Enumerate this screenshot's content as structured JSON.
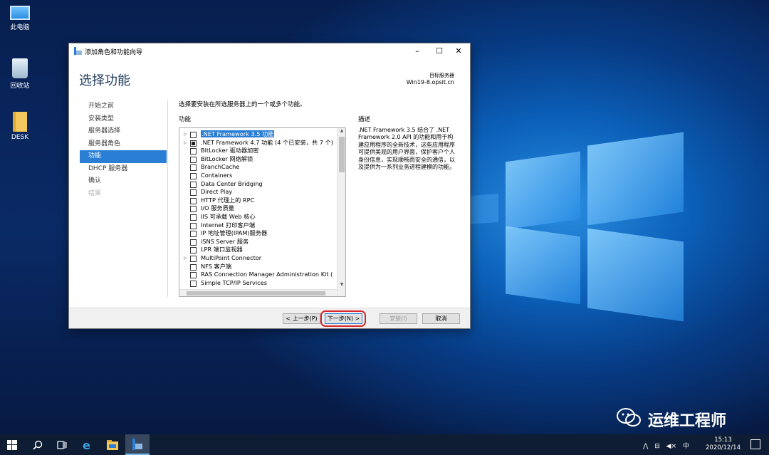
{
  "desktop": {
    "icons": [
      {
        "label": "此电脑",
        "icon": "computer-icon"
      },
      {
        "label": "回收站",
        "icon": "recycle-bin-icon"
      },
      {
        "label": "DESK",
        "icon": "folder-icon"
      }
    ]
  },
  "dialog": {
    "title": "添加角色和功能向导",
    "page_title": "选择功能",
    "destination_label": "目标服务器",
    "destination_server": "Win19-8.opsit.cn",
    "steps": [
      {
        "label": "开始之前",
        "state": "normal"
      },
      {
        "label": "安装类型",
        "state": "normal"
      },
      {
        "label": "服务器选择",
        "state": "normal"
      },
      {
        "label": "服务器角色",
        "state": "normal"
      },
      {
        "label": "功能",
        "state": "active"
      },
      {
        "label": "DHCP 服务器",
        "state": "normal"
      },
      {
        "label": "确认",
        "state": "normal"
      },
      {
        "label": "结果",
        "state": "disabled"
      }
    ],
    "instruction": "选择要安装在所选服务器上的一个或多个功能。",
    "features_header": "功能",
    "description_header": "描述",
    "features": [
      {
        "label": ".NET Framework 3.5 功能",
        "expandable": true,
        "state": "unchecked",
        "selected": true
      },
      {
        "label": ".NET Framework 4.7 功能 (4 个已安装，共 7 个)",
        "expandable": true,
        "state": "partial"
      },
      {
        "label": "BitLocker 驱动器加密",
        "expandable": false,
        "state": "unchecked"
      },
      {
        "label": "BitLocker 网络解锁",
        "expandable": false,
        "state": "unchecked"
      },
      {
        "label": "BranchCache",
        "expandable": false,
        "state": "unchecked"
      },
      {
        "label": "Containers",
        "expandable": false,
        "state": "unchecked"
      },
      {
        "label": "Data Center Bridging",
        "expandable": false,
        "state": "unchecked"
      },
      {
        "label": "Direct Play",
        "expandable": false,
        "state": "unchecked"
      },
      {
        "label": "HTTP 代理上的 RPC",
        "expandable": false,
        "state": "unchecked"
      },
      {
        "label": "I/O 服务质量",
        "expandable": false,
        "state": "unchecked"
      },
      {
        "label": "IIS 可承载 Web 核心",
        "expandable": false,
        "state": "unchecked"
      },
      {
        "label": "Internet 打印客户端",
        "expandable": false,
        "state": "unchecked"
      },
      {
        "label": "IP 地址管理(IPAM)服务器",
        "expandable": false,
        "state": "unchecked"
      },
      {
        "label": "iSNS Server 服务",
        "expandable": false,
        "state": "unchecked"
      },
      {
        "label": "LPR 端口监视器",
        "expandable": false,
        "state": "unchecked"
      },
      {
        "label": "MultiPoint Connector",
        "expandable": true,
        "state": "unchecked"
      },
      {
        "label": "NFS 客户端",
        "expandable": false,
        "state": "unchecked"
      },
      {
        "label": "RAS Connection Manager Administration Kit (",
        "expandable": false,
        "state": "unchecked"
      },
      {
        "label": "Simple TCP/IP Services",
        "expandable": false,
        "state": "unchecked"
      }
    ],
    "description": ".NET Framework 3.5 结合了 .NET Framework 2.0 API 的功能和用于构建应用程序的全新技术，这些应用程序可提供美观的用户界面，保护客户个人身份信息，实现顺畅而安全的通信，以及提供为一系列业务进程建模的功能。",
    "buttons": {
      "prev": "< 上一步(P)",
      "next": "下一步(N) >",
      "install": "安装(I)",
      "cancel": "取消"
    }
  },
  "watermark": "运维工程师",
  "taskbar": {
    "time": "15:13",
    "date": "2020/12/14",
    "ime": "中"
  }
}
